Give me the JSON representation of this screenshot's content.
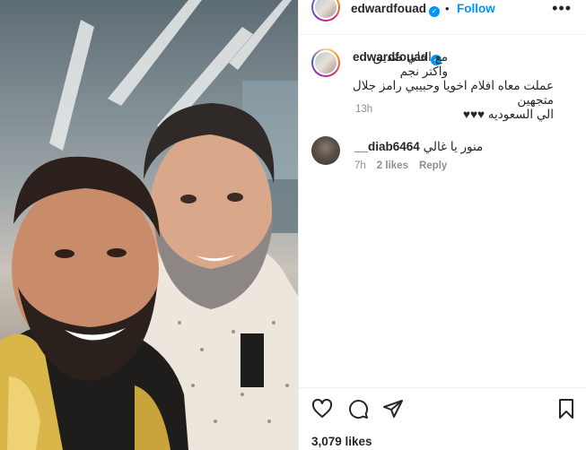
{
  "post": {
    "username": "edwardfouad",
    "follow_label": "Follow",
    "separator": "•",
    "more_label": "•••",
    "verified_mark": "✓"
  },
  "caption": {
    "username": "edwardfouad",
    "line1": "مع احلي صديق واكتر نجم",
    "line2": "عملت معاه افلام اخويا وحبيبي رامز جلال متجهين",
    "line3": "الي السعوديه ♥♥♥",
    "time": "13h"
  },
  "comment": {
    "username": "__diab6464",
    "text": "منور يا غالي",
    "time": "7h",
    "likes": "2 likes",
    "reply_label": "Reply"
  },
  "actions": {
    "icons": [
      "heart-icon",
      "comment-icon",
      "share-icon",
      "bookmark-icon"
    ]
  },
  "likes_count": "3,079 likes",
  "colors": {
    "accent": "#0095f6",
    "text": "#262626",
    "muted": "#8e8e8e"
  }
}
